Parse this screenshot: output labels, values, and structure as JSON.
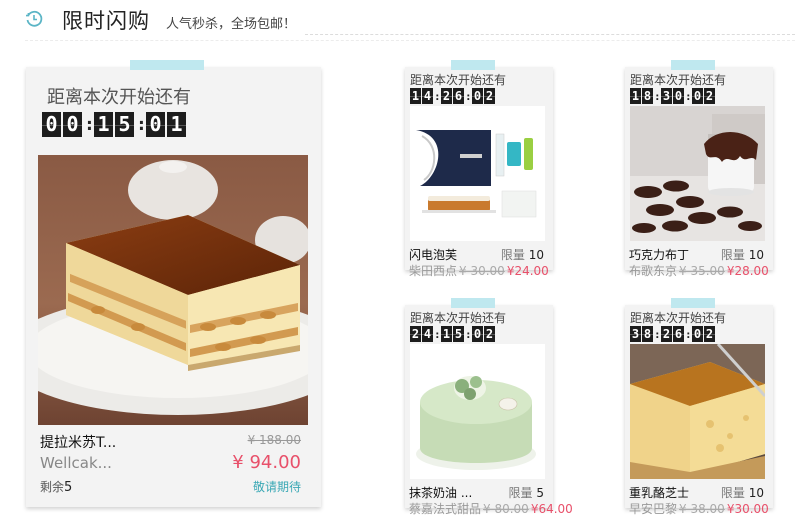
{
  "header": {
    "title": "限时闪购",
    "subtitle": "人气秒杀，全场包邮！",
    "icon": "clock-icon"
  },
  "featured": {
    "countdown_label": "距离本次开始还有",
    "timer": [
      "0",
      "0",
      "1",
      "5",
      "0",
      "1"
    ],
    "name": "提拉米苏T...",
    "old_price": "¥ 188.00",
    "shop": "Wellcak...",
    "new_price": "¥ 94.00",
    "stock_label": "剩余",
    "stock_value": "5",
    "remind": "敬请期待"
  },
  "items": [
    {
      "countdown_label": "距离本次开始还有",
      "timer": [
        "1",
        "4",
        "2",
        "6",
        "0",
        "2"
      ],
      "name": "闪电泡芙",
      "limit_label": "限量",
      "limit_value": "10",
      "shop": "柴田西点",
      "old_price": "¥ 30.00",
      "new_price": "¥24.00"
    },
    {
      "countdown_label": "距离本次开始还有",
      "timer": [
        "1",
        "8",
        "3",
        "0",
        "0",
        "2"
      ],
      "name": "巧克力布丁",
      "limit_label": "限量",
      "limit_value": "10",
      "shop": "布歌东京",
      "old_price": "¥ 35.00",
      "new_price": "¥28.00"
    },
    {
      "countdown_label": "距离本次开始还有",
      "timer": [
        "2",
        "4",
        "1",
        "5",
        "0",
        "2"
      ],
      "name": "抹茶奶油 ...",
      "limit_label": "限量",
      "limit_value": "5",
      "shop": "蔡嘉法式甜品",
      "old_price": "¥ 80.00",
      "new_price": "¥64.00"
    },
    {
      "countdown_label": "距离本次开始还有",
      "timer": [
        "3",
        "8",
        "2",
        "6",
        "0",
        "2"
      ],
      "name": "重乳酪芝士",
      "limit_label": "限量",
      "limit_value": "10",
      "shop": "早安巴黎",
      "old_price": "¥ 38.00",
      "new_price": "¥30.00"
    }
  ],
  "colors": {
    "accent_price": "#e8506a",
    "tab": "#bfe8ef",
    "remind": "#3aa8b5"
  }
}
